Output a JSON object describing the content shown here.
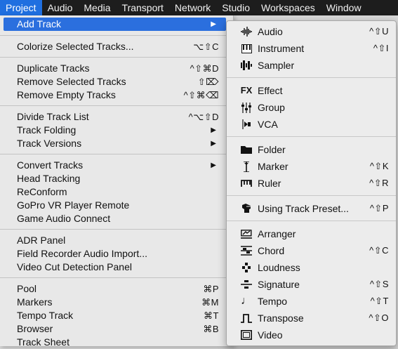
{
  "menubar": {
    "items": [
      "Project",
      "Audio",
      "Media",
      "Transport",
      "Network",
      "Studio",
      "Workspaces",
      "Window"
    ],
    "active": "Project"
  },
  "project_menu": {
    "add_track": "Add Track",
    "colorize": {
      "label": "Colorize Selected Tracks...",
      "shortcut": "⌥⇧C"
    },
    "duplicate": {
      "label": "Duplicate Tracks",
      "shortcut": "^⇧⌘D"
    },
    "remove_selected": {
      "label": "Remove Selected Tracks",
      "shortcut": "⇧⌦"
    },
    "remove_empty": {
      "label": "Remove Empty Tracks",
      "shortcut": "^⇧⌘⌫"
    },
    "divide": {
      "label": "Divide Track List",
      "shortcut": "^⌥⇧D"
    },
    "folding": "Track Folding",
    "versions": "Track Versions",
    "convert": "Convert Tracks",
    "head_tracking": "Head Tracking",
    "reconform": "ReConform",
    "gopro": "GoPro VR Player Remote",
    "game_audio": "Game Audio Connect",
    "adr": "ADR Panel",
    "field_recorder": "Field Recorder Audio Import...",
    "video_cut": "Video Cut Detection Panel",
    "pool": {
      "label": "Pool",
      "shortcut": "⌘P"
    },
    "markers": {
      "label": "Markers",
      "shortcut": "⌘M"
    },
    "tempo_track": {
      "label": "Tempo Track",
      "shortcut": "⌘T"
    },
    "browser": {
      "label": "Browser",
      "shortcut": "⌘B"
    },
    "track_sheet": "Track Sheet"
  },
  "add_track_submenu": {
    "audio": {
      "label": "Audio",
      "shortcut": "^⇧U",
      "icon": "waveform-icon"
    },
    "instrument": {
      "label": "Instrument",
      "shortcut": "^⇧I",
      "icon": "keyboard-icon"
    },
    "sampler": {
      "label": "Sampler",
      "shortcut": "",
      "icon": "sampler-icon"
    },
    "effect": {
      "label": "Effect",
      "shortcut": "",
      "icon": "fx-icon"
    },
    "group": {
      "label": "Group",
      "shortcut": "",
      "icon": "group-faders-icon"
    },
    "vca": {
      "label": "VCA",
      "shortcut": "",
      "icon": "vca-icon"
    },
    "folder": {
      "label": "Folder",
      "shortcut": "",
      "icon": "folder-icon"
    },
    "marker": {
      "label": "Marker",
      "shortcut": "^⇧K",
      "icon": "marker-icon"
    },
    "ruler": {
      "label": "Ruler",
      "shortcut": "^⇧R",
      "icon": "ruler-icon"
    },
    "preset": {
      "label": "Using Track Preset...",
      "shortcut": "^⇧P",
      "icon": "preset-icon"
    },
    "arranger": {
      "label": "Arranger",
      "shortcut": "",
      "icon": "arranger-icon"
    },
    "chord": {
      "label": "Chord",
      "shortcut": "^⇧C",
      "icon": "chord-icon"
    },
    "loudness": {
      "label": "Loudness",
      "shortcut": "",
      "icon": "loudness-icon"
    },
    "signature": {
      "label": "Signature",
      "shortcut": "^⇧S",
      "icon": "signature-icon"
    },
    "tempo": {
      "label": "Tempo",
      "shortcut": "^⇧T",
      "icon": "tempo-note-icon"
    },
    "transpose": {
      "label": "Transpose",
      "shortcut": "^⇧O",
      "icon": "transpose-icon"
    },
    "video": {
      "label": "Video",
      "shortcut": "",
      "icon": "video-frame-icon"
    }
  },
  "colors": {
    "highlight": "#2b6fde",
    "menubar": "#1d1d1d"
  }
}
